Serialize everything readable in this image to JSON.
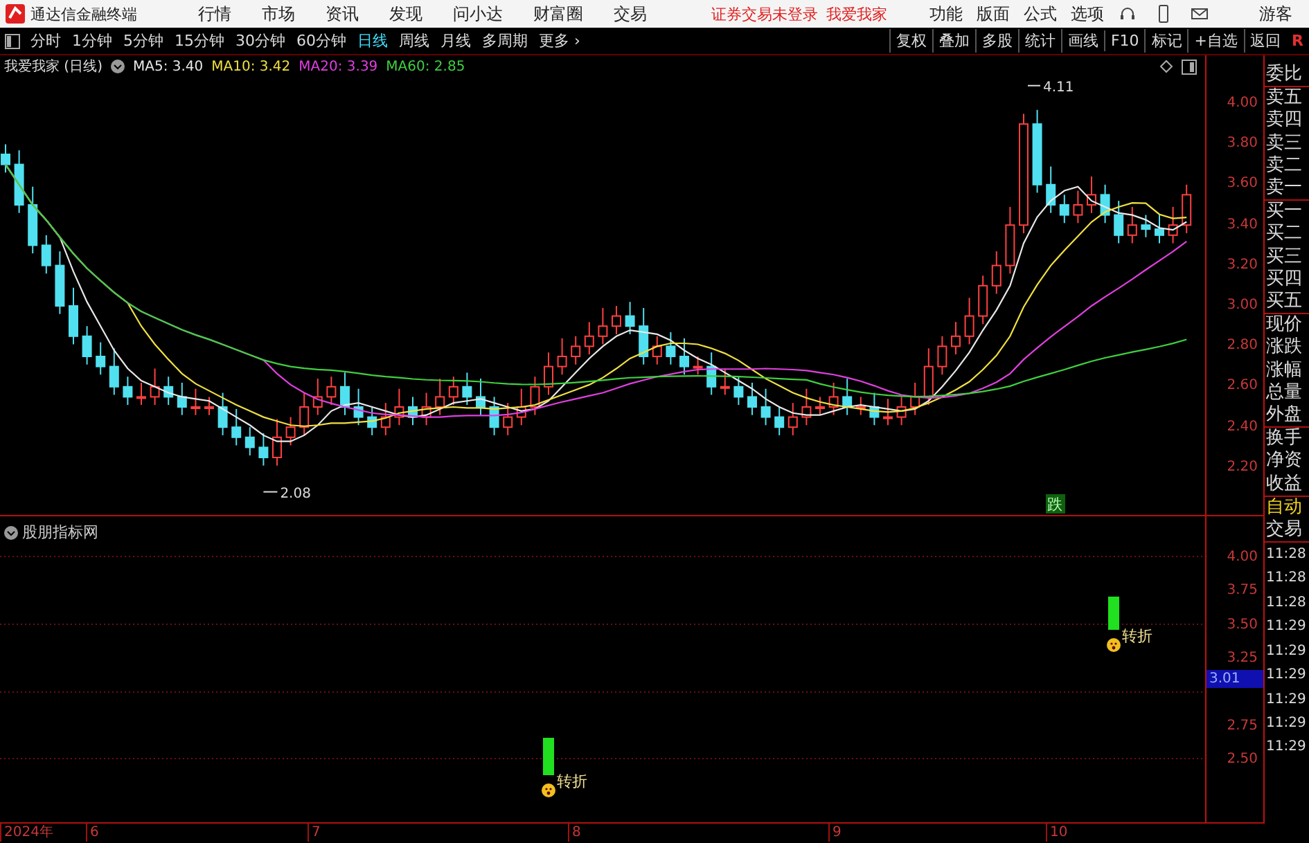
{
  "title_bar": {
    "app_name": "通达信金融终端",
    "menu": [
      "行情",
      "市场",
      "资讯",
      "发现",
      "问小达",
      "财富圈",
      "交易"
    ],
    "notice": [
      "证券交易未登录",
      "我爱我家"
    ],
    "tools": [
      "功能",
      "版面",
      "公式",
      "选项"
    ],
    "user": "游客"
  },
  "toolbar": {
    "periods": [
      {
        "label": "分时",
        "selected": false
      },
      {
        "label": "1分钟",
        "selected": false
      },
      {
        "label": "5分钟",
        "selected": false
      },
      {
        "label": "15分钟",
        "selected": false
      },
      {
        "label": "30分钟",
        "selected": false
      },
      {
        "label": "60分钟",
        "selected": false
      },
      {
        "label": "日线",
        "selected": true
      },
      {
        "label": "周线",
        "selected": false
      },
      {
        "label": "月线",
        "selected": false
      },
      {
        "label": "多周期",
        "selected": false
      }
    ],
    "more": "更多 ›",
    "actions": [
      "复权",
      "叠加",
      "多股",
      "统计",
      "画线",
      "F10",
      "标记",
      "+自选",
      "返回"
    ],
    "corner": "R"
  },
  "chart": {
    "title": "我爱我家 (日线)",
    "averages": [
      {
        "label": "MA5: 3.40",
        "color": "#e8e8e8"
      },
      {
        "label": "MA10: 3.42",
        "color": "#f0e040"
      },
      {
        "label": "MA20: 3.39",
        "color": "#e040e0"
      },
      {
        "label": "MA60: 2.85",
        "color": "#40d040"
      }
    ],
    "high_label": "4.11",
    "low_label": "2.08",
    "signal": "跌",
    "yticks": [
      "4.00",
      "3.80",
      "3.60",
      "3.40",
      "3.20",
      "3.00",
      "2.80",
      "2.60",
      "2.40",
      "2.20"
    ]
  },
  "indicator": {
    "title": "股朋指标网",
    "yticks": [
      "4.00",
      "3.75",
      "3.50",
      "3.25",
      "2.75",
      "2.50"
    ],
    "current": "3.01",
    "signals": [
      {
        "label": "转折"
      },
      {
        "label": "转折"
      }
    ]
  },
  "date_axis": [
    "2024年",
    "6",
    "7",
    "8",
    "9",
    "10"
  ],
  "quote_panel": {
    "sections": [
      [
        "委比"
      ],
      [
        "卖五",
        "卖四",
        "卖三",
        "卖二",
        "卖一"
      ],
      [
        "买一",
        "买二",
        "买三",
        "买四",
        "买五"
      ],
      [
        "现价",
        "涨跌",
        "涨幅",
        "总量",
        "外盘"
      ],
      [
        "换手",
        "净资",
        "收益"
      ]
    ]
  },
  "trade_panel": {
    "mode": "自动",
    "title": "交易",
    "times": [
      "11:28",
      "11:28",
      "11:28",
      "11:29",
      "11:29",
      "11:29",
      "11:29",
      "11:29",
      "11:29"
    ]
  }
}
